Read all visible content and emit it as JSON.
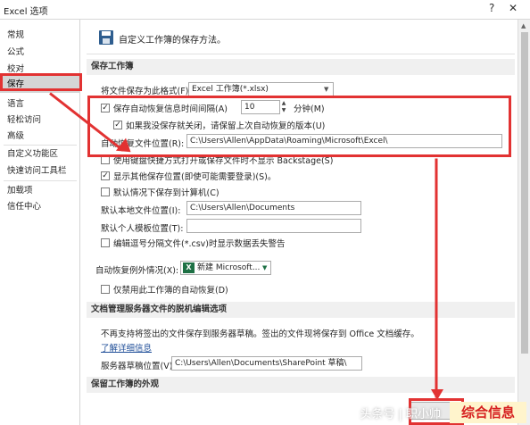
{
  "window": {
    "title": "Excel 选项",
    "help_glyph": "?",
    "close_glyph": "✕"
  },
  "sidebar": {
    "items": [
      {
        "label": "常规"
      },
      {
        "label": "公式"
      },
      {
        "label": "校对"
      },
      {
        "label": "保存"
      },
      {
        "label": "语言"
      },
      {
        "label": "轻松访问"
      },
      {
        "label": "高级"
      },
      {
        "label": "自定义功能区"
      },
      {
        "label": "快速访问工具栏"
      },
      {
        "label": "加载项"
      },
      {
        "label": "信任中心"
      }
    ],
    "selected": "保存"
  },
  "header": {
    "icon": "save-icon",
    "text": "自定义工作簿的保存方法。"
  },
  "save_workbooks": {
    "section_title": "保存工作簿",
    "format_label": "将文件保存为此格式(F):",
    "format_value": "Excel 工作簿(*.xlsx)",
    "autorecover_label": "保存自动恢复信息时间间隔(A)",
    "autorecover_checked": true,
    "autorecover_minutes": "10",
    "minutes_label": "分钟(M)",
    "keep_last_label": "如果我没保存就关闭，请保留上次自动恢复的版本(U)",
    "keep_last_checked": true,
    "autorecover_location_label": "自动恢复文件位置(R):",
    "autorecover_location_value": "C:\\Users\\Allen\\AppData\\Roaming\\Microsoft\\Excel\\",
    "backstage_label": "使用键盘快捷方式打开或保存文件时不显示 Backstage(S)",
    "backstage_checked": false,
    "show_more_label": "显示其他保存位置(即使可能需要登录)(S)。",
    "show_more_checked": true,
    "default_computer_label": "默认情况下保存到计算机(C)",
    "default_computer_checked": false,
    "local_location_label": "默认本地文件位置(I):",
    "local_location_value": "C:\\Users\\Allen\\Documents",
    "personal_templates_label": "默认个人模板位置(T):",
    "personal_templates_value": "",
    "csv_warning_label": "编辑逗号分隔文件(*.csv)时显示数据丢失警告",
    "csv_warning_checked": false
  },
  "autorecover_exceptions": {
    "label": "自动恢复例外情况(X):",
    "workbook_value": "新建 Microsoft...",
    "disable_label": "仅禁用此工作簿的自动恢复(D)",
    "disable_checked": false
  },
  "offline_editing": {
    "section_title": "文档管理服务器文件的脱机编辑选项",
    "description": "不再支持将签出的文件保存到服务器草稿。签出的文件现将保存到 Office 文档缓存。",
    "learn_more_link": "了解详细信息",
    "drafts_label": "服务器草稿位置(V):",
    "drafts_value": "C:\\Users\\Allen\\Documents\\SharePoint 草稿\\"
  },
  "appearance": {
    "section_title": "保留工作簿的外观"
  },
  "watermark": {
    "text": "头条号 | 职小帅",
    "brand": "综合信息"
  },
  "colors": {
    "accent_red": "#e23232",
    "selected_bg": "#d5d5d5",
    "excel_green": "#1e7145"
  }
}
